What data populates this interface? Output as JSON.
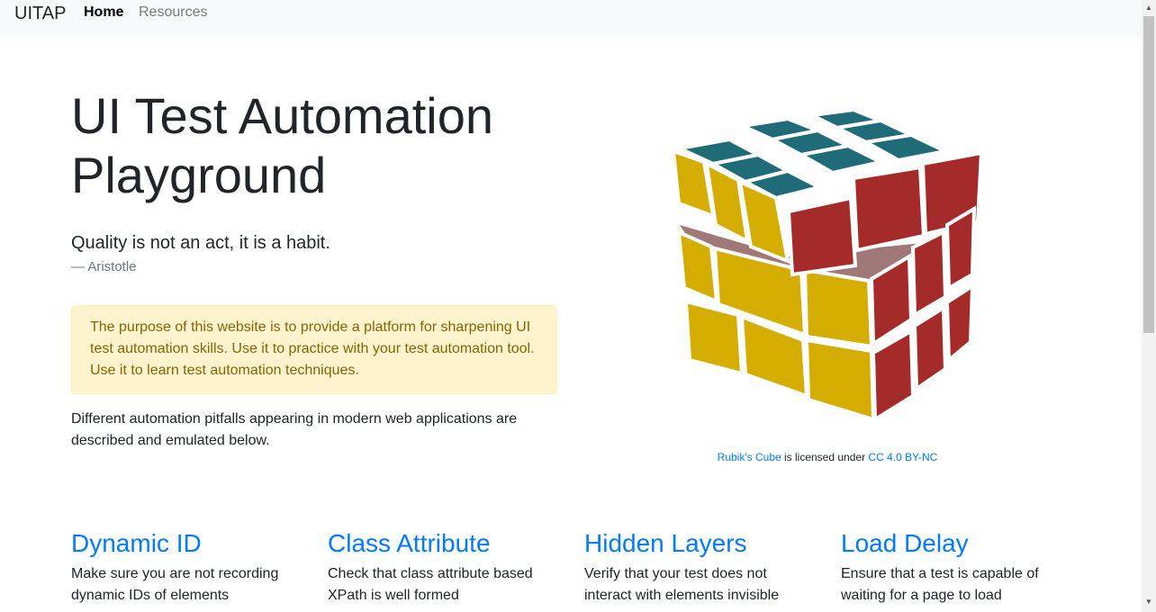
{
  "nav": {
    "brand": "UITAP",
    "home": "Home",
    "resources": "Resources"
  },
  "hero": {
    "title": "UI Test Automation Playground",
    "quote": "Quality is not an act, it is a habit.",
    "author": "— Aristotle"
  },
  "alert": "The purpose of this website is to provide a platform for sharpening UI test automation skills. Use it to practice with your test automation tool. Use it to learn test automation techniques.",
  "description": "Different automation pitfalls appearing in modern web applications are described and emulated below.",
  "image": {
    "name": "rubiks-cube-icon",
    "colors": {
      "top": "#1f6b78",
      "left": "#d4ad00",
      "right": "#a52a2a",
      "gap": "#a07878"
    }
  },
  "caption": {
    "link1": "Rubik's Cube",
    "middle": " is licensed under ",
    "link2": "CC 4.0 BY-NC"
  },
  "cards": [
    {
      "title": "Dynamic ID",
      "text": "Make sure you are not recording dynamic IDs of elements"
    },
    {
      "title": "Class Attribute",
      "text": "Check that class attribute based XPath is well formed"
    },
    {
      "title": "Hidden Layers",
      "text": "Verify that your test does not interact with elements invisible"
    },
    {
      "title": "Load Delay",
      "text": "Ensure that a test is capable of waiting for a page to load"
    }
  ],
  "colors": {
    "link": "#007bff",
    "navbar_bg": "#f8f9fa",
    "alert_bg": "#fff3cd",
    "alert_text": "#856404"
  }
}
